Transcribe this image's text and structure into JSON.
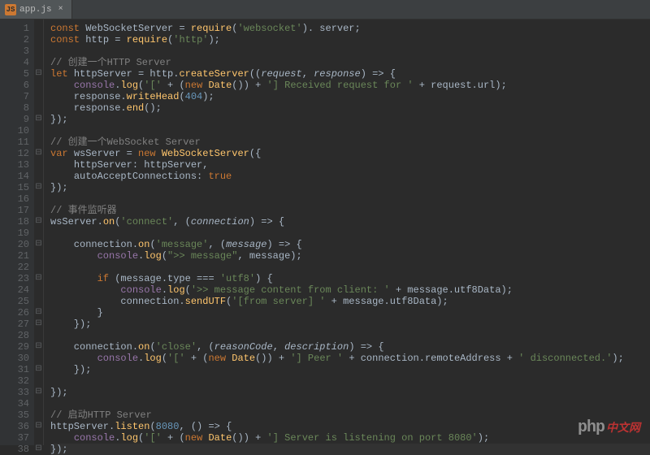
{
  "tab": {
    "filename": "app.js",
    "icon_label": "JS"
  },
  "watermark": {
    "left": "php",
    "right": "中文网"
  },
  "code": {
    "lines": [
      {
        "n": 1,
        "fold": "",
        "tokens": [
          [
            "kw",
            "const "
          ],
          [
            "",
            "WebSocketServer = "
          ],
          [
            "fn",
            "require"
          ],
          [
            "",
            "("
          ],
          [
            "str",
            "'websocket'"
          ],
          [
            "",
            "). "
          ],
          [
            "",
            "server;"
          ]
        ]
      },
      {
        "n": 2,
        "fold": "",
        "tokens": [
          [
            "kw",
            "const "
          ],
          [
            "",
            "http = "
          ],
          [
            "fn",
            "require"
          ],
          [
            "",
            "("
          ],
          [
            "str",
            "'http'"
          ],
          [
            "",
            ");"
          ]
        ]
      },
      {
        "n": 3,
        "fold": "",
        "tokens": [
          [
            "",
            ""
          ]
        ]
      },
      {
        "n": 4,
        "fold": "",
        "tokens": [
          [
            "comment",
            "// 创建一个HTTP Server"
          ]
        ]
      },
      {
        "n": 5,
        "fold": "⊟",
        "tokens": [
          [
            "kw",
            "let "
          ],
          [
            "",
            "httpServer = http."
          ],
          [
            "fn",
            "createServer"
          ],
          [
            "",
            "(("
          ],
          [
            "param",
            "request"
          ],
          [
            "",
            ", "
          ],
          [
            "param",
            "response"
          ],
          [
            "",
            ") => {"
          ]
        ]
      },
      {
        "n": 6,
        "fold": "",
        "tokens": [
          [
            "",
            "    "
          ],
          [
            "glob",
            "console"
          ],
          [
            "",
            "."
          ],
          [
            "fn",
            "log"
          ],
          [
            "",
            "("
          ],
          [
            "str",
            "'['"
          ],
          [
            "",
            " + ("
          ],
          [
            "kw",
            "new "
          ],
          [
            "fn",
            "Date"
          ],
          [
            "",
            "()) + "
          ],
          [
            "str",
            "'] Received request for '"
          ],
          [
            "",
            " + request.url);"
          ]
        ]
      },
      {
        "n": 7,
        "fold": "",
        "tokens": [
          [
            "",
            "    response."
          ],
          [
            "fn",
            "writeHead"
          ],
          [
            "",
            "("
          ],
          [
            "num",
            "404"
          ],
          [
            "",
            ");"
          ]
        ]
      },
      {
        "n": 8,
        "fold": "",
        "tokens": [
          [
            "",
            "    response."
          ],
          [
            "fn",
            "end"
          ],
          [
            "",
            "();"
          ]
        ]
      },
      {
        "n": 9,
        "fold": "⊟",
        "tokens": [
          [
            "",
            "});"
          ]
        ]
      },
      {
        "n": 10,
        "fold": "",
        "tokens": [
          [
            "",
            ""
          ]
        ]
      },
      {
        "n": 11,
        "fold": "",
        "tokens": [
          [
            "comment",
            "// 创建一个WebSocket Server"
          ]
        ]
      },
      {
        "n": 12,
        "fold": "⊟",
        "tokens": [
          [
            "kw",
            "var "
          ],
          [
            "",
            "wsServer = "
          ],
          [
            "kw",
            "new "
          ],
          [
            "fn",
            "WebSocketServer"
          ],
          [
            "",
            "({"
          ]
        ]
      },
      {
        "n": 13,
        "fold": "",
        "tokens": [
          [
            "",
            "    "
          ],
          [
            "",
            "httpServer"
          ],
          [
            "",
            ": httpServer,"
          ]
        ]
      },
      {
        "n": 14,
        "fold": "",
        "tokens": [
          [
            "",
            "    "
          ],
          [
            "",
            "autoAcceptConnections"
          ],
          [
            "",
            ": "
          ],
          [
            "kw",
            "true"
          ]
        ]
      },
      {
        "n": 15,
        "fold": "⊟",
        "tokens": [
          [
            "",
            "});"
          ]
        ]
      },
      {
        "n": 16,
        "fold": "",
        "tokens": [
          [
            "",
            ""
          ]
        ]
      },
      {
        "n": 17,
        "fold": "",
        "tokens": [
          [
            "comment",
            "// 事件监听器"
          ]
        ]
      },
      {
        "n": 18,
        "fold": "⊟",
        "tokens": [
          [
            "",
            "wsServer."
          ],
          [
            "fn",
            "on"
          ],
          [
            "",
            "("
          ],
          [
            "str",
            "'connect'"
          ],
          [
            "",
            ", ("
          ],
          [
            "param",
            "connection"
          ],
          [
            "",
            ") => {"
          ]
        ]
      },
      {
        "n": 19,
        "fold": "",
        "tokens": [
          [
            "",
            ""
          ]
        ]
      },
      {
        "n": 20,
        "fold": "⊟",
        "tokens": [
          [
            "",
            "    connection."
          ],
          [
            "fn",
            "on"
          ],
          [
            "",
            "("
          ],
          [
            "str",
            "'message'"
          ],
          [
            "",
            ", ("
          ],
          [
            "param",
            "message"
          ],
          [
            "",
            ") => {"
          ]
        ]
      },
      {
        "n": 21,
        "fold": "",
        "tokens": [
          [
            "",
            "        "
          ],
          [
            "glob",
            "console"
          ],
          [
            "",
            "."
          ],
          [
            "fn",
            "log"
          ],
          [
            "",
            "("
          ],
          [
            "str",
            "\">> message\""
          ],
          [
            "",
            ", message);"
          ]
        ]
      },
      {
        "n": 22,
        "fold": "",
        "tokens": [
          [
            "",
            ""
          ]
        ]
      },
      {
        "n": 23,
        "fold": "⊟",
        "tokens": [
          [
            "",
            "        "
          ],
          [
            "kw",
            "if "
          ],
          [
            "",
            "(message.type === "
          ],
          [
            "str",
            "'utf8'"
          ],
          [
            "",
            ") {"
          ]
        ]
      },
      {
        "n": 24,
        "fold": "",
        "tokens": [
          [
            "",
            "            "
          ],
          [
            "glob",
            "console"
          ],
          [
            "",
            "."
          ],
          [
            "fn",
            "log"
          ],
          [
            "",
            "("
          ],
          [
            "str",
            "'>> message content from client: '"
          ],
          [
            "",
            " + message.utf8Data);"
          ]
        ]
      },
      {
        "n": 25,
        "fold": "",
        "tokens": [
          [
            "",
            "            connection."
          ],
          [
            "fn",
            "sendUTF"
          ],
          [
            "",
            "("
          ],
          [
            "str",
            "'[from server] '"
          ],
          [
            "",
            " + message.utf8Data);"
          ]
        ]
      },
      {
        "n": 26,
        "fold": "⊟",
        "tokens": [
          [
            "",
            "        }"
          ]
        ]
      },
      {
        "n": 27,
        "fold": "⊟",
        "tokens": [
          [
            "",
            "    });"
          ]
        ]
      },
      {
        "n": 28,
        "fold": "",
        "tokens": [
          [
            "",
            ""
          ]
        ]
      },
      {
        "n": 29,
        "fold": "⊟",
        "tokens": [
          [
            "",
            "    connection."
          ],
          [
            "fn",
            "on"
          ],
          [
            "",
            "("
          ],
          [
            "str",
            "'close'"
          ],
          [
            "",
            ", ("
          ],
          [
            "param",
            "reasonCode"
          ],
          [
            "",
            ", "
          ],
          [
            "param",
            "description"
          ],
          [
            "",
            ") => {"
          ]
        ]
      },
      {
        "n": 30,
        "fold": "",
        "tokens": [
          [
            "",
            "        "
          ],
          [
            "glob",
            "console"
          ],
          [
            "",
            "."
          ],
          [
            "fn",
            "log"
          ],
          [
            "",
            "("
          ],
          [
            "str",
            "'['"
          ],
          [
            "",
            " + ("
          ],
          [
            "kw",
            "new "
          ],
          [
            "fn",
            "Date"
          ],
          [
            "",
            "()) + "
          ],
          [
            "str",
            "'] Peer '"
          ],
          [
            "",
            " + connection.remoteAddress + "
          ],
          [
            "str",
            "' disconnected.'"
          ],
          [
            "",
            ");"
          ]
        ]
      },
      {
        "n": 31,
        "fold": "⊟",
        "tokens": [
          [
            "",
            "    });"
          ]
        ]
      },
      {
        "n": 32,
        "fold": "",
        "tokens": [
          [
            "",
            ""
          ]
        ]
      },
      {
        "n": 33,
        "fold": "⊟",
        "tokens": [
          [
            "",
            "});"
          ]
        ]
      },
      {
        "n": 34,
        "fold": "",
        "tokens": [
          [
            "",
            ""
          ]
        ]
      },
      {
        "n": 35,
        "fold": "",
        "tokens": [
          [
            "comment",
            "// 启动HTTP Server"
          ]
        ]
      },
      {
        "n": 36,
        "fold": "⊟",
        "tokens": [
          [
            "",
            "httpServer."
          ],
          [
            "fn",
            "listen"
          ],
          [
            "",
            "("
          ],
          [
            "num",
            "8080"
          ],
          [
            "",
            ", () => {"
          ]
        ]
      },
      {
        "n": 37,
        "fold": "",
        "tokens": [
          [
            "",
            "    "
          ],
          [
            "glob",
            "console"
          ],
          [
            "",
            "."
          ],
          [
            "fn",
            "log"
          ],
          [
            "",
            "("
          ],
          [
            "str",
            "'['"
          ],
          [
            "",
            " + ("
          ],
          [
            "kw",
            "new "
          ],
          [
            "fn",
            "Date"
          ],
          [
            "",
            "()) + "
          ],
          [
            "str",
            "'] Server is listening on port 8080'"
          ],
          [
            "",
            ");"
          ]
        ]
      },
      {
        "n": 38,
        "fold": "⊟",
        "tokens": [
          [
            "",
            "});"
          ]
        ],
        "cursor": true
      }
    ]
  }
}
